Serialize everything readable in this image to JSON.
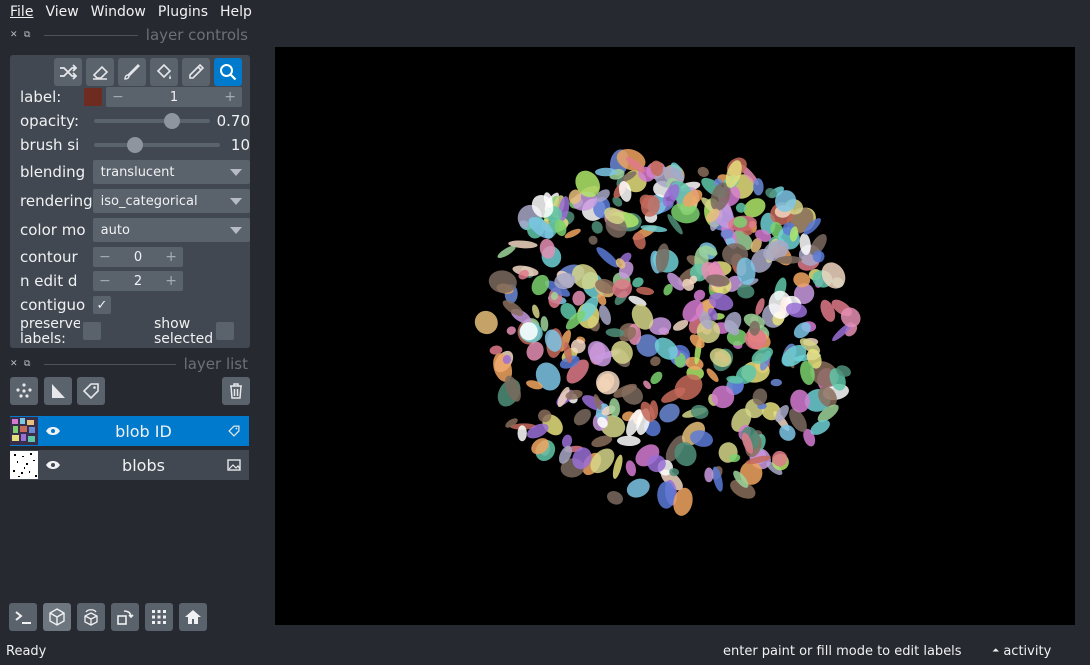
{
  "menu": [
    "File",
    "View",
    "Window",
    "Plugins",
    "Help"
  ],
  "dock": {
    "controls_title": "layer controls",
    "list_title": "layer list"
  },
  "controls": {
    "tools": [
      "shuffle-colors-icon",
      "erase-icon",
      "paint-brush-icon",
      "fill-bucket-icon",
      "color-picker-icon",
      "zoom-pan-icon"
    ],
    "active_tool": "zoom-pan-icon",
    "label": {
      "text": "label:",
      "value": "1",
      "swatch_color": "#6e2c20",
      "minus": "−",
      "plus": "+"
    },
    "opacity": {
      "text": "opacity:",
      "value": "0.70",
      "fraction": 0.7
    },
    "brush": {
      "text": "brush si",
      "value": "10",
      "fraction": 0.3
    },
    "blending": {
      "text": "blending",
      "value": "translucent"
    },
    "rendering": {
      "text": "rendering",
      "value": "iso_categorical"
    },
    "color_mode": {
      "text": "color mo",
      "value": "auto"
    },
    "contour": {
      "text": "contour",
      "value": "0"
    },
    "n_edit": {
      "text": "n edit d",
      "value": "2"
    },
    "contiguous": {
      "text": "contiguo",
      "checked": true
    },
    "preserve": {
      "text": "preserve labels:"
    },
    "show_selected": {
      "text": "show selected"
    }
  },
  "layers": [
    {
      "name": "blob ID",
      "selected": true,
      "type_icon": "label-tag-icon"
    },
    {
      "name": "blobs",
      "selected": false,
      "type_icon": "image-icon"
    }
  ],
  "status": {
    "ready": "Ready",
    "hint": "enter paint or fill mode to edit labels",
    "activity": "activity",
    "activity_arrow": "⏶"
  },
  "colors": {
    "bg": "#262930",
    "panel": "#414851",
    "button": "#5a626c",
    "accent": "#007acc"
  }
}
